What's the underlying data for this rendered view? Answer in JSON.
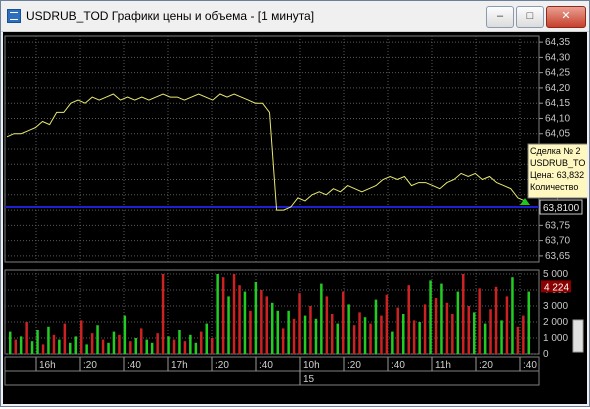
{
  "window": {
    "title": "USDRUB_TOD Графики цены и объема - [1 минута]",
    "minimize_icon": "minimize-icon",
    "maximize_icon": "maximize-icon",
    "close_icon": "close-icon"
  },
  "chart_data": [
    {
      "type": "line",
      "pane": "price",
      "xlabel": "",
      "ylabel": "",
      "ylim": [
        63.63,
        64.37
      ],
      "y_ticks": [
        "64,35",
        "64,30",
        "64,25",
        "64,20",
        "64,15",
        "64,10",
        "64,05",
        "64,00",
        "63,95",
        "63,90",
        "63,85",
        "63,80",
        "63,75",
        "63,70",
        "63,65"
      ],
      "grid": true,
      "colors": {
        "line": "#e8e870",
        "level": "#1f1fd0",
        "triangle": "#1ec81e",
        "background": "#000000",
        "grid": "#5a5a5a"
      },
      "series": [
        {
          "values": [
            64.04,
            64.05,
            64.05,
            64.06,
            64.07,
            64.09,
            64.08,
            64.12,
            64.12,
            64.15,
            64.16,
            64.15,
            64.17,
            64.16,
            64.17,
            64.18,
            64.16,
            64.17,
            64.16,
            64.17,
            64.16,
            64.17,
            64.18,
            64.17,
            64.17,
            64.16,
            64.17,
            64.18,
            64.17,
            64.16,
            64.18,
            64.17,
            64.18,
            64.17,
            64.16,
            64.15,
            64.15,
            64.12,
            63.8,
            63.8,
            63.81,
            63.84,
            63.83,
            63.85,
            63.86,
            63.85,
            63.87,
            63.86,
            63.88,
            63.87,
            63.86,
            63.87,
            63.88,
            63.9,
            63.91,
            63.9,
            63.91,
            63.88,
            63.89,
            63.89,
            63.88,
            63.87,
            63.89,
            63.9,
            63.92,
            63.91,
            63.92,
            63.9,
            63.91,
            63.89,
            63.88,
            63.87,
            63.84,
            63.83
          ]
        }
      ],
      "level_line": 63.81,
      "price_label": "63,8100"
    },
    {
      "type": "bar",
      "pane": "volume",
      "xlabel": "",
      "ylabel": "",
      "ylim": [
        0,
        5000
      ],
      "y_ticks": [
        "5 000",
        "4 000",
        "3 000",
        "2 000",
        "1 000",
        "0"
      ],
      "volume_label": "4 224",
      "colors": {
        "up": "#22cc22",
        "down": "#cc2222"
      },
      "values": [
        1400,
        900,
        1100,
        2000,
        800,
        1500,
        600,
        1700,
        1200,
        900,
        1900,
        700,
        1100,
        2100,
        600,
        1300,
        1800,
        900,
        700,
        1400,
        1200,
        2400,
        800,
        1000,
        1600,
        900,
        700,
        1300,
        5000,
        1100,
        900,
        1500,
        800,
        1200,
        700,
        1400,
        1900,
        1000,
        5000,
        4800,
        3600,
        5000,
        4300,
        3900,
        2700,
        4500,
        4000,
        3600,
        3200,
        2700,
        1600,
        2700,
        2200,
        3800,
        2400,
        3000,
        2200,
        4400,
        3600,
        2500,
        1900,
        3900,
        3100,
        1800,
        2600,
        2300,
        1900,
        3400,
        2400,
        3700,
        1400,
        2900,
        2500,
        4300,
        2100,
        2000,
        3100,
        4600,
        3500,
        4400,
        3200,
        2500,
        3900,
        5000,
        3000,
        2600,
        4100,
        1900,
        2800,
        4200,
        2100,
        3600,
        4800,
        1700,
        2400,
        3900
      ],
      "directions": [
        1,
        0,
        1,
        0,
        1,
        1,
        0,
        1,
        0,
        1,
        0,
        1,
        1,
        0,
        1,
        0,
        1,
        0,
        1,
        1,
        0,
        1,
        0,
        1,
        0,
        1,
        1,
        0,
        0,
        1,
        0,
        1,
        0,
        1,
        1,
        0,
        1,
        0,
        1,
        0,
        1,
        0,
        0,
        1,
        0,
        1,
        0,
        0,
        1,
        1,
        0,
        1,
        0,
        0,
        1,
        0,
        1,
        1,
        0,
        0,
        1,
        0,
        1,
        0,
        0,
        1,
        0,
        1,
        0,
        0,
        1,
        0,
        1,
        0,
        0,
        1,
        0,
        1,
        0,
        1,
        0,
        0,
        1,
        0,
        0,
        1,
        0,
        1,
        0,
        0,
        1,
        0,
        1,
        0,
        0,
        1
      ]
    }
  ],
  "time_axis": {
    "labels": [
      "16h",
      ":20",
      ":40",
      "17h",
      ":20",
      ":40",
      "10h",
      ":20",
      ":40",
      "11h",
      ":20",
      ":40"
    ],
    "date_label": "15"
  },
  "tooltip": {
    "line1": "Сделка № 2",
    "line2": "USDRUB_TO",
    "line3": "Цена: 63,832",
    "line4": "Количество"
  }
}
